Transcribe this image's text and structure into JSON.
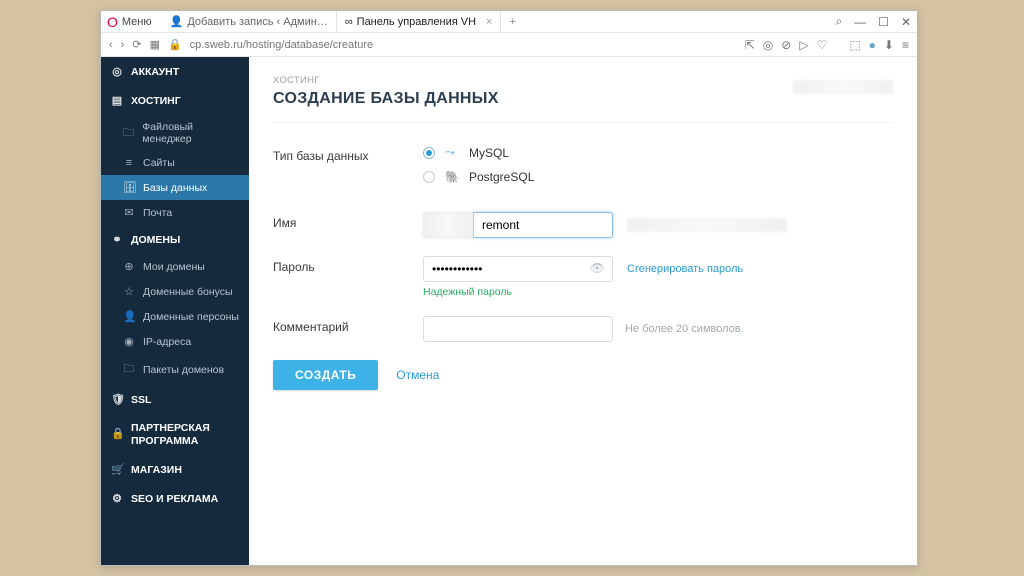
{
  "browser": {
    "menu": "Меню",
    "tabs": [
      {
        "label": "Добавить запись ‹ Админ…"
      },
      {
        "label": "Панель управления VH"
      }
    ],
    "url": "cp.sweb.ru/hosting/database/creature"
  },
  "sidebar": {
    "sections": [
      {
        "label": "АККАУНТ",
        "icon": "◎"
      },
      {
        "label": "ХОСТИНГ",
        "icon": "▤",
        "items": [
          {
            "label": "Файловый менеджер",
            "icon": "🗀"
          },
          {
            "label": "Сайты",
            "icon": "≡"
          },
          {
            "label": "Базы данных",
            "icon": "🗄",
            "active": true
          },
          {
            "label": "Почта",
            "icon": "✉"
          }
        ]
      },
      {
        "label": "ДОМЕНЫ",
        "icon": "⚭",
        "items": [
          {
            "label": "Мои домены",
            "icon": "⊕"
          },
          {
            "label": "Доменные бонусы",
            "icon": "☆"
          },
          {
            "label": "Доменные персоны",
            "icon": "👤"
          },
          {
            "label": "IP-адреса",
            "icon": "◉"
          },
          {
            "label": "Пакеты доменов",
            "icon": "🗀"
          }
        ]
      },
      {
        "label": "SSL",
        "icon": "🛡"
      },
      {
        "label": "ПАРТНЕРСКАЯ ПРОГРАММА",
        "icon": "🔒"
      },
      {
        "label": "МАГАЗИН",
        "icon": "🛒"
      },
      {
        "label": "SEO И РЕКЛАМА",
        "icon": "⚙"
      }
    ]
  },
  "page": {
    "breadcrumb": "ХОСТИНГ",
    "title": "СОЗДАНИЕ БАЗЫ ДАННЫХ"
  },
  "form": {
    "db_type_label": "Тип базы данных",
    "db_types": [
      {
        "label": "MySQL",
        "checked": true,
        "icon": "⤳"
      },
      {
        "label": "PostgreSQL",
        "checked": false,
        "icon": "🐘"
      }
    ],
    "name_label": "Имя",
    "name_value": "remont",
    "password_label": "Пароль",
    "password_generate": "Сгенерировать пароль",
    "password_strength": "Надежный пароль",
    "comment_label": "Комментарий",
    "comment_hint": "Не более 20 символов.",
    "submit": "СОЗДАТЬ",
    "cancel": "Отмена"
  }
}
